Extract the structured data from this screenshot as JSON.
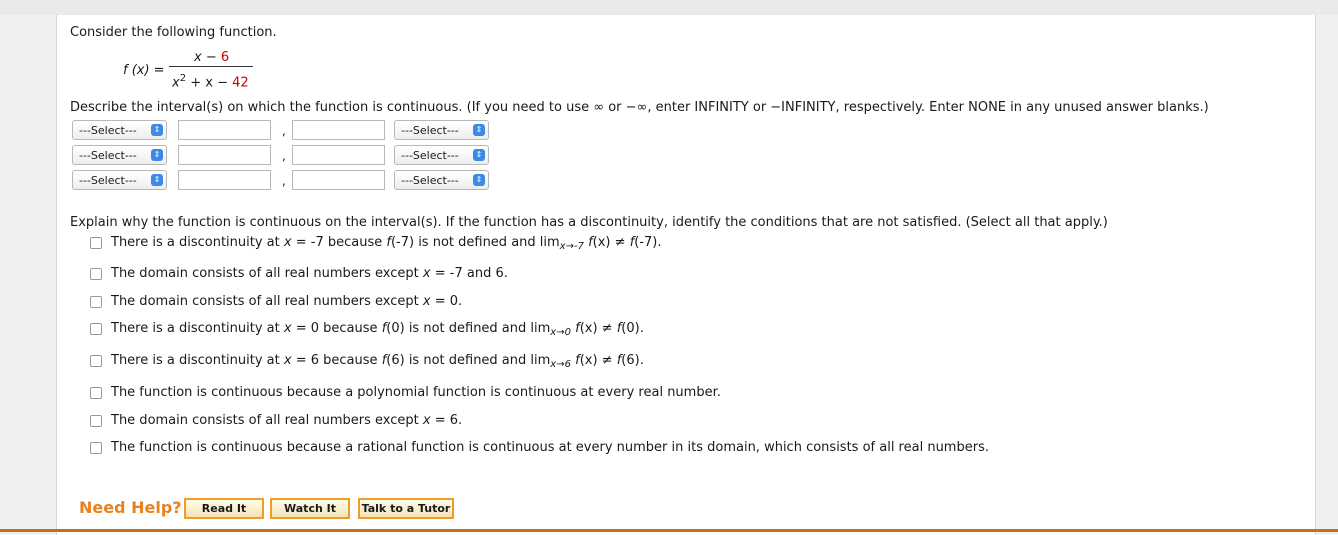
{
  "question": {
    "prompt": "Consider the following function.",
    "function": {
      "label": "f (x) =",
      "numerator_var": "x",
      "numerator_op": "−",
      "numerator_const": "6",
      "denominator_var": "x",
      "denominator_exp": "2",
      "denominator_mid": "+ x −",
      "denominator_const": "42"
    },
    "describe": "Describe the interval(s) on which the function is continuous. (If you need to use ∞ or −∞, enter INFINITY or −INFINITY, respectively. Enter NONE in any unused answer blanks.)",
    "select_placeholder": "---Select---",
    "comma": ",",
    "explain": "Explain why the function is continuous on the interval(s). If the function has a discontinuity, identify the conditions that are not satisfied. (Select all that apply.)",
    "options": [
      {
        "pre": "There is a discontinuity at",
        "var": "x",
        "mid": "= -7 because",
        "f": "f",
        "mid2": "(-7) is not defined and lim",
        "sub": "x→-7",
        "post_f": "f",
        "post": "(x) ≠",
        "post_f2": "f",
        "end": "(-7)."
      },
      {
        "text_a": "The domain consists of all real numbers except",
        "var": "x",
        "text_b": "= -7 and 6."
      },
      {
        "text_a": "The domain consists of all real numbers except",
        "var": "x",
        "text_b": "= 0."
      },
      {
        "pre": "There is a discontinuity at",
        "var": "x",
        "mid": "= 0 because",
        "f": "f",
        "mid2": "(0) is not defined and lim",
        "sub": "x→0",
        "post_f": "f",
        "post": "(x) ≠",
        "post_f2": "f",
        "end": "(0)."
      },
      {
        "pre": "There is a discontinuity at",
        "var": "x",
        "mid": "= 6 because",
        "f": "f",
        "mid2": "(6) is not defined and lim",
        "sub": "x→6",
        "post_f": "f",
        "post": "(x) ≠",
        "post_f2": "f",
        "end": "(6)."
      },
      {
        "text": "The function is continuous because a polynomial function is continuous at every real number."
      },
      {
        "text_a": "The domain consists of all real numbers except",
        "var": "x",
        "text_b": "= 6."
      },
      {
        "text": "The function is continuous because a rational function is continuous at every number in its domain, which consists of all real numbers."
      }
    ]
  },
  "help": {
    "label": "Need Help?",
    "read": "Read It",
    "watch": "Watch It",
    "tutor": "Talk to a Tutor"
  },
  "colors": {
    "accent_red": "#cc0000",
    "help_orange": "#e8821e",
    "select_blue": "#3b8ae6"
  }
}
